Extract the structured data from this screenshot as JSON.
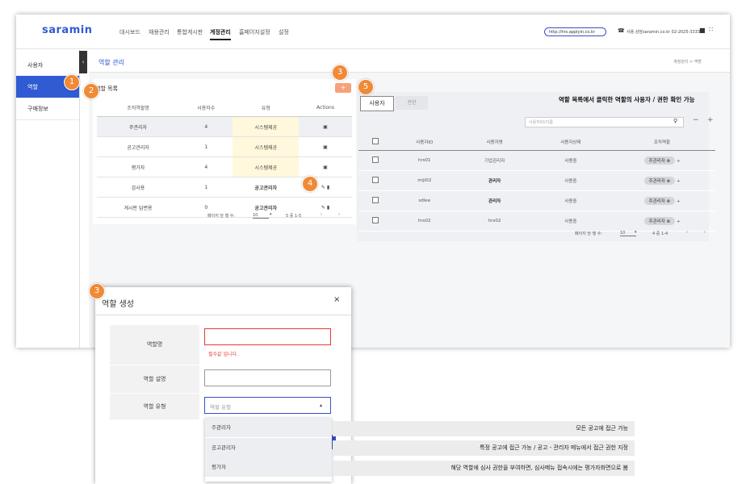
{
  "brand": {
    "logo": "saramin"
  },
  "nav": {
    "items": [
      "대시보드",
      "채용관리",
      "통합게시판",
      "계정관리",
      "홈페이지설정",
      "설정"
    ],
    "active": "계정관리"
  },
  "header": {
    "url": "http://hrs.applyin.co.kr",
    "phone": "사용 상담saramin.co.kr 02-2025-33333"
  },
  "sidebar": {
    "items": [
      "사용자",
      "역할",
      "구매정보"
    ],
    "active": "역할"
  },
  "page": {
    "title": "역할 관리",
    "breadcrumb": "계정관리 > 역할"
  },
  "role_list": {
    "title": "역할 목록",
    "add_label": "+",
    "columns": [
      "조직역할명",
      "사용자수",
      "유형",
      "Actions"
    ],
    "rows": [
      {
        "name": "주관리자",
        "count": "4",
        "type": "시스템제공"
      },
      {
        "name": "공고관리자",
        "count": "1",
        "type": "시스템제공"
      },
      {
        "name": "평가자",
        "count": "4",
        "type": "시스템제공"
      },
      {
        "name": "감사용",
        "count": "1",
        "type": "공고관리자"
      },
      {
        "name": "게시판 답변용",
        "count": "0",
        "type": "공고관리자"
      }
    ],
    "pager": {
      "per_page_label": "페이지 당 행 수:",
      "per_page": "10",
      "range": "5 중 1-5"
    }
  },
  "notice": "역할 목록에서 클릭한 역할의 사용자 / 권한 확인 가능",
  "user_panel": {
    "tabs": [
      "사용자",
      "권한"
    ],
    "search_placeholder": "사용자ID/이름",
    "columns": [
      "사용자ID",
      "사용자명",
      "사용자상태",
      "조직역할"
    ],
    "rows": [
      {
        "id": "hrs01",
        "name": "기업관리자",
        "status": "사용중",
        "role": "주관리자"
      },
      {
        "id": "miji02",
        "name": "관리자",
        "status": "사용중",
        "role": "주관리자"
      },
      {
        "id": "sdlee",
        "name": "관리자",
        "status": "사용중",
        "role": "주관리자"
      },
      {
        "id": "hrs02",
        "name": "hrs02",
        "status": "사용중",
        "role": "주관리자"
      }
    ],
    "pager": {
      "per_page_label": "페이지 당 행 수:",
      "per_page": "10",
      "range": "4 중 1-4"
    }
  },
  "modal": {
    "title": "역할 생성",
    "close": "×",
    "fields": {
      "name_label": "역할명",
      "name_error": "필수값 입니다.",
      "desc_label": "역할 설명",
      "type_label": "역할 유형",
      "type_placeholder": "역할 유형"
    },
    "options": [
      "주관리자",
      "공고관리자",
      "평가자"
    ]
  },
  "descriptions": [
    "모든 공고에 접근 가능",
    "특정 공고에 접근 가능 / 공고 - 관리자 메뉴에서 접근 권한 지정",
    "해당 역할에 심사 권한을 부여하면, 심사메뉴 접속시에는 평가자화면으로 봄"
  ],
  "badges": [
    "1",
    "2",
    "3",
    "4",
    "5",
    "3"
  ],
  "colors": {
    "accent": "#2f5bd3",
    "badge": "#f08a36",
    "add_button": "#f7a17b",
    "error": "#e53935"
  }
}
